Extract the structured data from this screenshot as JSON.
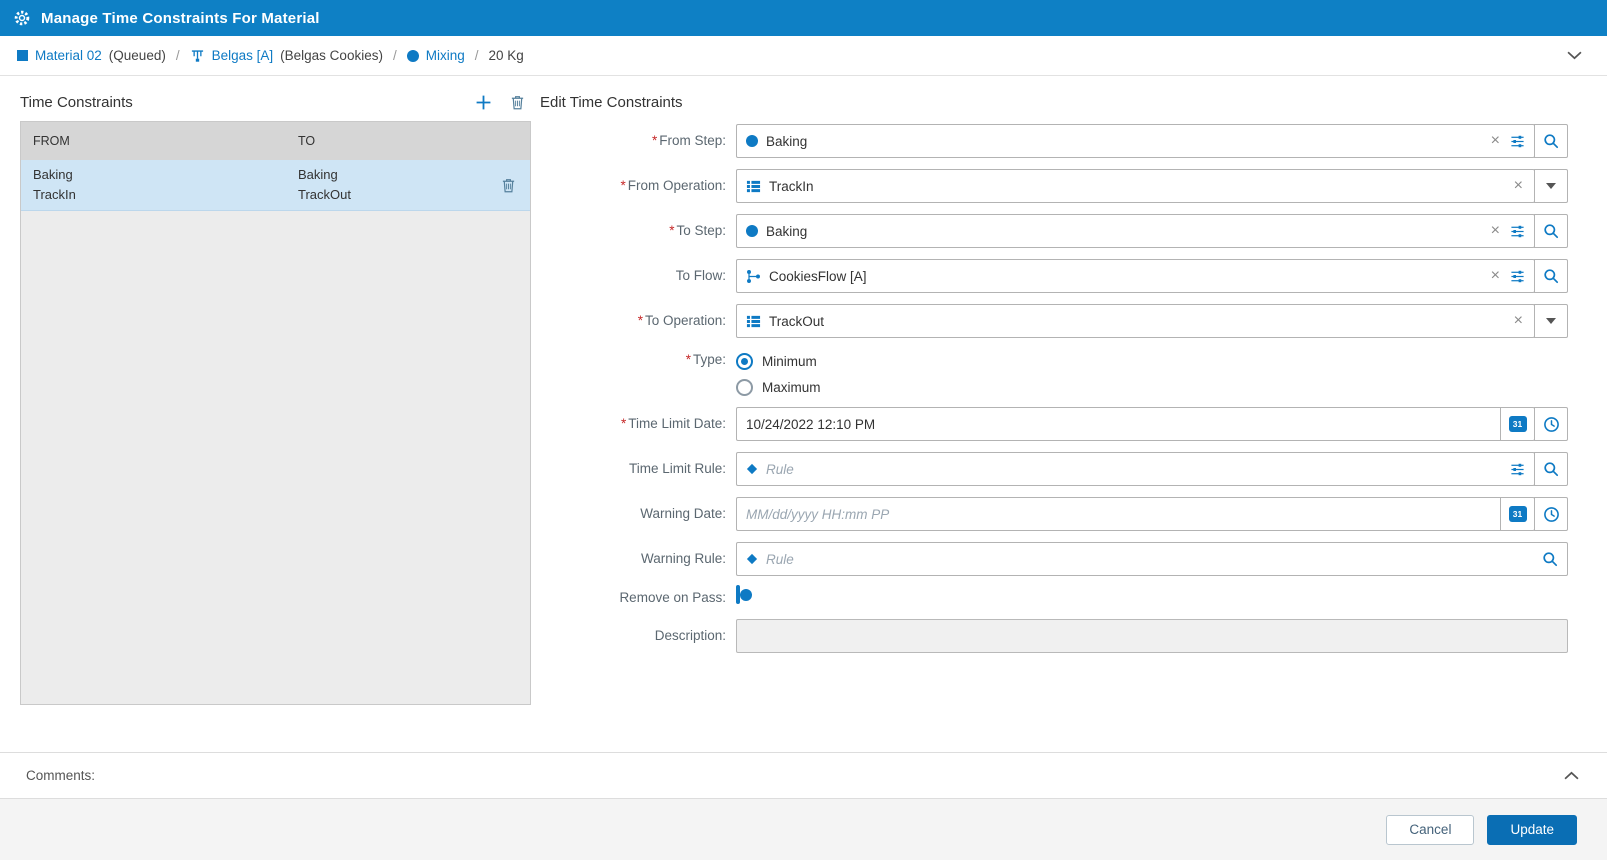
{
  "titlebar": {
    "title": "Manage Time Constraints For Material"
  },
  "breadcrumb": {
    "material_label": "Material 02",
    "material_status": "(Queued)",
    "separator": "/",
    "flow_label": "Belgas [A]",
    "flow_desc": "(Belgas Cookies)",
    "step_label": "Mixing",
    "quantity": "20 Kg"
  },
  "left_panel": {
    "title": "Time Constraints",
    "columns": {
      "from": "FROM",
      "to": "TO"
    },
    "rows": [
      {
        "from_step": "Baking",
        "from_operation": "TrackIn",
        "to_step": "Baking",
        "to_operation": "TrackOut"
      }
    ]
  },
  "form": {
    "title": "Edit Time Constraints",
    "required_marker": "*",
    "from_step": {
      "label": "From Step:",
      "value": "Baking"
    },
    "from_operation": {
      "label": "From Operation:",
      "value": "TrackIn"
    },
    "to_step": {
      "label": "To Step:",
      "value": "Baking"
    },
    "to_flow": {
      "label": "To Flow:",
      "value": "CookiesFlow [A]"
    },
    "to_operation": {
      "label": "To Operation:",
      "value": "TrackOut"
    },
    "type": {
      "label": "Type:",
      "option_minimum": "Minimum",
      "option_maximum": "Maximum",
      "selected": "Minimum"
    },
    "time_limit_date": {
      "label": "Time Limit Date:",
      "value": "10/24/2022 12:10 PM"
    },
    "time_limit_rule": {
      "label": "Time Limit Rule:",
      "placeholder": "Rule"
    },
    "warning_date": {
      "label": "Warning Date:",
      "placeholder": "MM/dd/yyyy HH:mm PP"
    },
    "warning_rule": {
      "label": "Warning Rule:",
      "placeholder": "Rule"
    },
    "remove_on_pass": {
      "label": "Remove on Pass:",
      "enabled": false
    },
    "description": {
      "label": "Description:",
      "value": ""
    }
  },
  "icons": {
    "clear": "×",
    "calendar_day": "31"
  },
  "comments": {
    "label": "Comments:"
  },
  "footer": {
    "cancel_label": "Cancel",
    "update_label": "Update"
  },
  "colors": {
    "accent": "#0e7ac4",
    "titlebar": "#0e80c5",
    "selected_row": "#cfe5f5",
    "update_button": "#0a6eb4"
  }
}
